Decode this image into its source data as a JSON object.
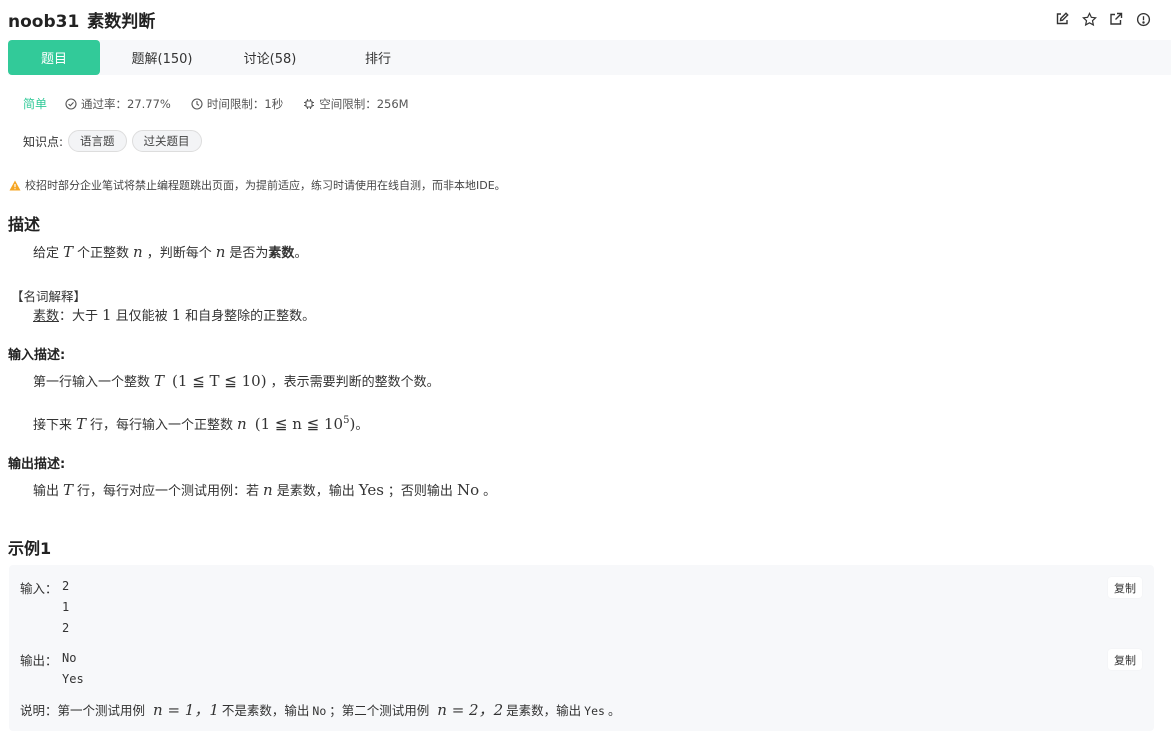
{
  "header": {
    "problem_id": "noob31",
    "problem_name": "素数判断",
    "icons": [
      "edit-icon",
      "star-icon",
      "share-icon",
      "report-icon"
    ]
  },
  "tabs": [
    {
      "label": "题目",
      "active": true
    },
    {
      "label": "题解(150)",
      "active": false
    },
    {
      "label": "讨论(58)",
      "active": false
    },
    {
      "label": "排行",
      "active": false
    }
  ],
  "meta": {
    "difficulty": "简单",
    "pass_rate": "通过率：27.77%",
    "time_limit": "时间限制：1秒",
    "space_limit": "空间限制：256M"
  },
  "knowledge": {
    "label": "知识点:",
    "tags": [
      "语言题",
      "过关题目"
    ]
  },
  "warning": "校招时部分企业笔试将禁止编程题跳出页面，为提前适应，练习时请使用在线自测，而非本地IDE。",
  "description": {
    "heading": "描述",
    "line1": {
      "a": "给定",
      "v1": "T",
      "b": "个正整数",
      "v2": "n",
      "c": "，判断每个",
      "v3": "n",
      "d": "是否为",
      "e": "素数",
      "f": "。"
    },
    "term_heading": "【名词解释】",
    "term": {
      "word": "素数",
      "a": "：大于",
      "v1": "1",
      "b": "且仅能被",
      "v2": "1",
      "c": "和自身整除的正整数。"
    }
  },
  "input": {
    "heading": "输入描述:",
    "line1": {
      "a": "第一行输入一个整数",
      "v1": "T",
      "cond": "(1 ≦ T ≦ 10)",
      "b": "，表示需要判断的整数个数。"
    },
    "line2": {
      "a": "接下来",
      "v1": "T",
      "b": "行，每行输入一个正整数",
      "v2": "n",
      "cond_a": "(1 ≦ n ≦ 10",
      "cond_exp": "5",
      "cond_b": ")",
      "c": "。"
    }
  },
  "output": {
    "heading": "输出描述:",
    "line1": {
      "a": "输出",
      "v1": "T",
      "b": "行，每行对应一个测试用例：若",
      "v2": "n",
      "c": "是素数，输出",
      "yes": "Yes",
      "d": "；否则输出",
      "no": "No",
      "e": "。"
    }
  },
  "example": {
    "heading": "示例1",
    "input_label": "输入：",
    "input_lines": [
      "2",
      "1",
      "2"
    ],
    "output_label": "输出：",
    "output_lines": [
      "No",
      "Yes"
    ],
    "copy_label": "复制",
    "explain": {
      "label": "说明：",
      "a": "第一个测试用例",
      "eq1": "n = 1，1",
      "b": "不是素数，输出",
      "c1": "No",
      "c": "；第二个测试用例",
      "eq2": "n = 2，2",
      "d": "是素数，输出",
      "c2": "Yes",
      "e": "。"
    }
  },
  "colors": {
    "accent": "#32ca99",
    "warning": "#f5a623",
    "tab_bg": "#f7f8fa"
  }
}
